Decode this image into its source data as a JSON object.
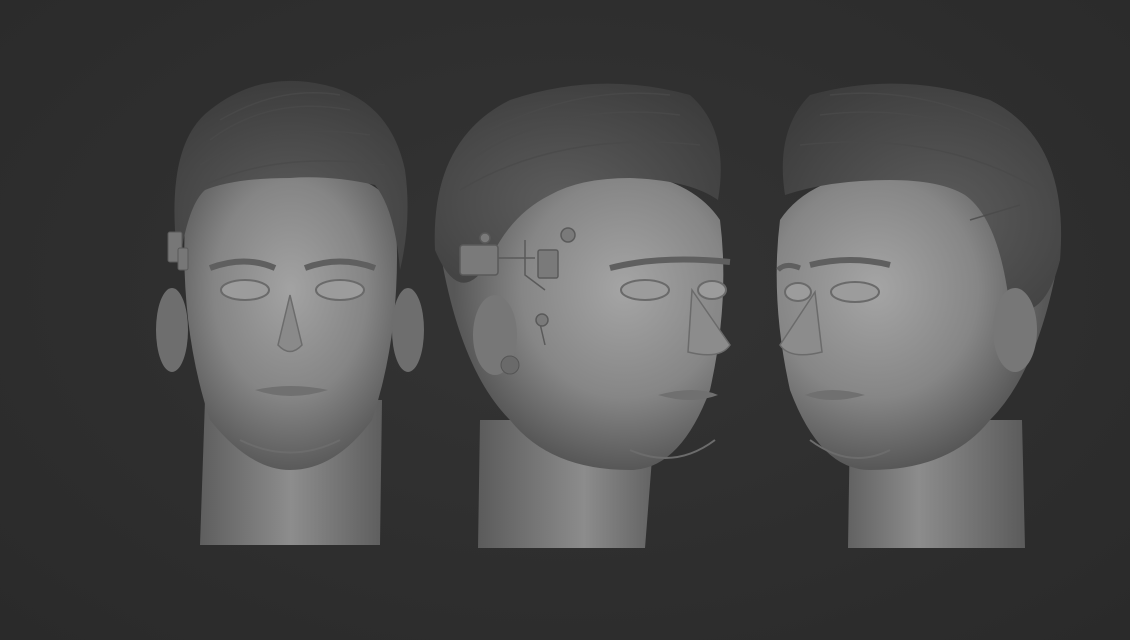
{
  "scene": {
    "background_color": "#2f2f2f",
    "clay_color": "#8e8e8e",
    "views": [
      {
        "view": "front"
      },
      {
        "view": "three-quarter-right"
      },
      {
        "view": "three-quarter-left"
      }
    ]
  }
}
